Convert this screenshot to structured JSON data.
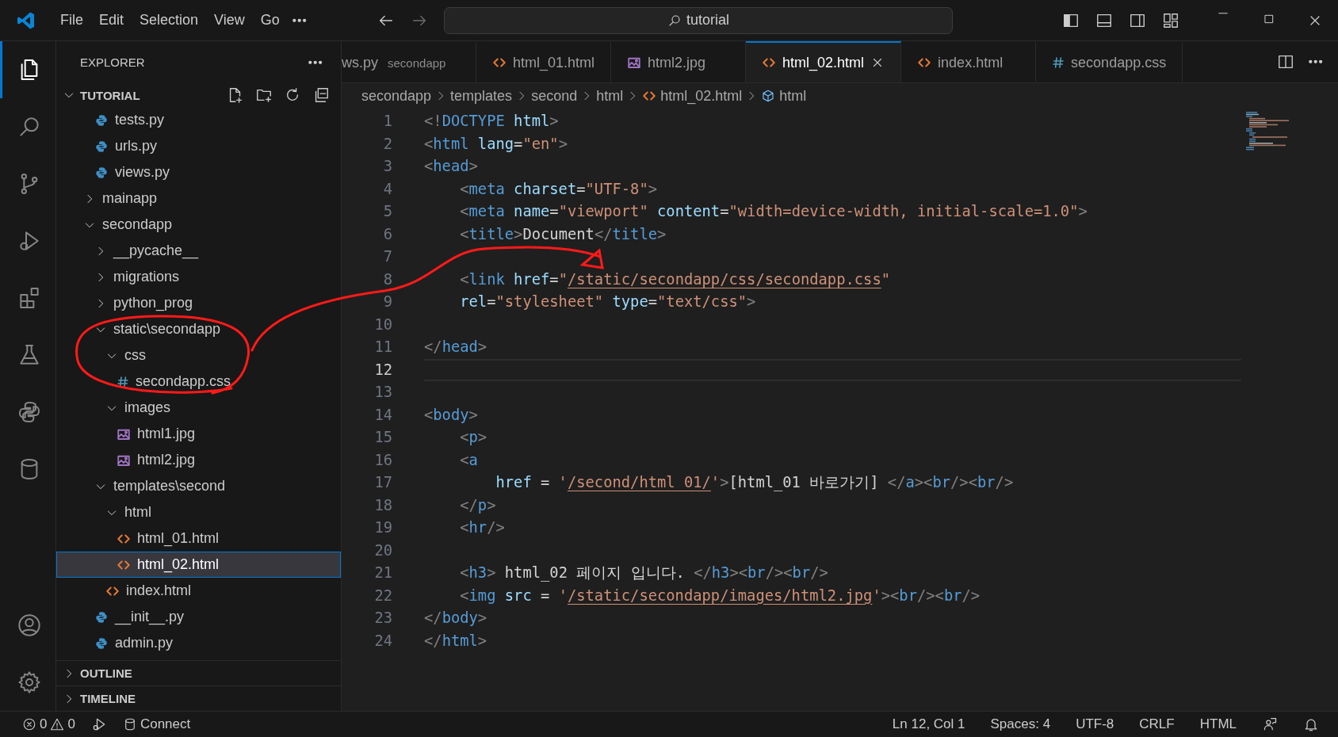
{
  "title_bar": {
    "menu": [
      "File",
      "Edit",
      "Selection",
      "View",
      "Go"
    ],
    "search": {
      "label": "tutorial"
    }
  },
  "activity_bar": {
    "items": [
      {
        "kind": "explorer",
        "selected": true
      },
      {
        "kind": "search",
        "selected": false
      },
      {
        "kind": "source_control",
        "selected": false
      },
      {
        "kind": "run_debug",
        "selected": false
      },
      {
        "kind": "extensions",
        "selected": false
      },
      {
        "kind": "testing",
        "selected": false
      },
      {
        "kind": "python",
        "selected": false
      },
      {
        "kind": "database",
        "selected": false
      }
    ],
    "bottom": [
      {
        "kind": "account"
      },
      {
        "kind": "settings"
      }
    ]
  },
  "explorer": {
    "title": "EXPLORER",
    "section": "TUTORIAL",
    "tree_continued": [
      {
        "label": "tests.py",
        "kind": "python",
        "selected": false
      },
      {
        "label": "urls.py",
        "kind": "python",
        "selected": false
      },
      {
        "label": "views.py",
        "kind": "python",
        "selected": false
      }
    ],
    "tree": [
      {
        "label": "mainapp",
        "kind": "folder",
        "expanded": false,
        "selected": false
      },
      {
        "label": "secondapp",
        "kind": "folder",
        "expanded": true,
        "selected": false,
        "children": [
          {
            "label": "__pycache__",
            "kind": "folder",
            "expanded": false,
            "selected": false
          },
          {
            "label": "migrations",
            "kind": "folder",
            "expanded": false,
            "selected": false
          },
          {
            "label": "python_prog",
            "kind": "folder",
            "expanded": false,
            "selected": false
          },
          {
            "label": "static\\secondapp",
            "kind": "folder",
            "expanded": true,
            "selected": false,
            "children": [
              {
                "label": "css",
                "kind": "folder",
                "expanded": true,
                "selected": false,
                "children": [
                  {
                    "label": "secondapp.css",
                    "kind": "css",
                    "selected": false
                  }
                ]
              },
              {
                "label": "images",
                "kind": "folder",
                "expanded": true,
                "selected": false,
                "children": [
                  {
                    "label": "html1.jpg",
                    "kind": "image",
                    "selected": false
                  },
                  {
                    "label": "html2.jpg",
                    "kind": "image",
                    "selected": false
                  }
                ]
              }
            ]
          },
          {
            "label": "templates\\second",
            "kind": "folder",
            "expanded": true,
            "selected": false,
            "children": [
              {
                "label": "html",
                "kind": "folder",
                "expanded": true,
                "selected": false,
                "children": [
                  {
                    "label": "html_01.html",
                    "kind": "html",
                    "selected": false
                  },
                  {
                    "label": "html_02.html",
                    "kind": "html",
                    "selected": true
                  }
                ]
              },
              {
                "label": "index.html",
                "kind": "html",
                "selected": false
              }
            ]
          },
          {
            "label": "__init__.py",
            "kind": "python",
            "selected": false
          },
          {
            "label": "admin.py",
            "kind": "python",
            "selected": false
          }
        ]
      }
    ],
    "panels": [
      {
        "label": "OUTLINE",
        "expanded": false
      },
      {
        "label": "TIMELINE",
        "expanded": false
      }
    ]
  },
  "tabs": [
    {
      "label": "ws.py",
      "detail": "secondapp",
      "selected": false
    },
    {
      "label": "html_01.html",
      "kind": "html",
      "selected": false
    },
    {
      "label": "html2.jpg",
      "kind": "image",
      "selected": false
    },
    {
      "label": "html_02.html",
      "kind": "html",
      "selected": true
    },
    {
      "label": "index.html",
      "kind": "html",
      "selected": false
    },
    {
      "label": "secondapp.css",
      "kind": "css",
      "selected": false
    }
  ],
  "breadcrumb": [
    {
      "label": "secondapp"
    },
    {
      "label": "templates"
    },
    {
      "label": "second"
    },
    {
      "label": "html"
    },
    {
      "label": "html_02.html",
      "kind": "html"
    },
    {
      "label": "html",
      "kind": "element"
    }
  ],
  "editor": {
    "lines": [
      {
        "number": "1",
        "current": false,
        "tokens": [
          {
            "kind": "punct",
            "text": "<!"
          },
          {
            "kind": "tag",
            "text": "DOCTYPE"
          },
          {
            "kind": "attr",
            "text": " html"
          },
          {
            "kind": "punct",
            "text": ">"
          }
        ]
      },
      {
        "number": "2",
        "current": false,
        "tokens": [
          {
            "kind": "punct",
            "text": "<"
          },
          {
            "kind": "tag",
            "text": "html"
          },
          {
            "kind": "attr",
            "text": " lang"
          },
          {
            "kind": "text",
            "text": "="
          },
          {
            "kind": "string",
            "text": "\"en\""
          },
          {
            "kind": "punct",
            "text": ">"
          }
        ]
      },
      {
        "number": "3",
        "current": false,
        "tokens": [
          {
            "kind": "punct",
            "text": "<"
          },
          {
            "kind": "tag",
            "text": "head"
          },
          {
            "kind": "punct",
            "text": ">"
          }
        ]
      },
      {
        "number": "4",
        "current": false,
        "tokens": [
          {
            "kind": "punct",
            "text": "    <"
          },
          {
            "kind": "tag",
            "text": "meta"
          },
          {
            "kind": "attr",
            "text": " charset"
          },
          {
            "kind": "text",
            "text": "="
          },
          {
            "kind": "string",
            "text": "\"UTF-8\""
          },
          {
            "kind": "punct",
            "text": ">"
          }
        ]
      },
      {
        "number": "5",
        "current": false,
        "tokens": [
          {
            "kind": "punct",
            "text": "    <"
          },
          {
            "kind": "tag",
            "text": "meta"
          },
          {
            "kind": "attr",
            "text": " name"
          },
          {
            "kind": "text",
            "text": "="
          },
          {
            "kind": "string",
            "text": "\"viewport\""
          },
          {
            "kind": "attr",
            "text": " content"
          },
          {
            "kind": "text",
            "text": "="
          },
          {
            "kind": "string",
            "text": "\"width=device-width, initial-scale=1.0\""
          },
          {
            "kind": "punct",
            "text": ">"
          }
        ]
      },
      {
        "number": "6",
        "current": false,
        "tokens": [
          {
            "kind": "punct",
            "text": "    <"
          },
          {
            "kind": "tag",
            "text": "title"
          },
          {
            "kind": "punct",
            "text": ">"
          },
          {
            "kind": "text",
            "text": "Document"
          },
          {
            "kind": "punct",
            "text": "</"
          },
          {
            "kind": "tag",
            "text": "title"
          },
          {
            "kind": "punct",
            "text": ">"
          }
        ]
      },
      {
        "number": "7",
        "current": false
      },
      {
        "number": "8",
        "current": false,
        "tokens": [
          {
            "kind": "punct",
            "text": "    <"
          },
          {
            "kind": "tag",
            "text": "link"
          },
          {
            "kind": "attr",
            "text": " href"
          },
          {
            "kind": "text",
            "text": "="
          },
          {
            "kind": "string",
            "text": "\""
          },
          {
            "kind": "link",
            "text": "/static/secondapp/css/secondapp.css"
          },
          {
            "kind": "string",
            "text": "\""
          }
        ]
      },
      {
        "number": "9",
        "current": false,
        "tokens": [
          {
            "kind": "attr",
            "text": "    rel"
          },
          {
            "kind": "text",
            "text": "="
          },
          {
            "kind": "string",
            "text": "\"stylesheet\""
          },
          {
            "kind": "attr",
            "text": " type"
          },
          {
            "kind": "text",
            "text": "="
          },
          {
            "kind": "string",
            "text": "\"text/css\""
          },
          {
            "kind": "punct",
            "text": ">"
          }
        ]
      },
      {
        "number": "10",
        "current": false
      },
      {
        "number": "11",
        "current": false,
        "tokens": [
          {
            "kind": "punct",
            "text": "</"
          },
          {
            "kind": "tag",
            "text": "head"
          },
          {
            "kind": "punct",
            "text": ">"
          }
        ]
      },
      {
        "number": "12",
        "current": true
      },
      {
        "number": "13",
        "current": false
      },
      {
        "number": "14",
        "current": false,
        "tokens": [
          {
            "kind": "punct",
            "text": "<"
          },
          {
            "kind": "tag",
            "text": "body"
          },
          {
            "kind": "punct",
            "text": ">"
          }
        ]
      },
      {
        "number": "15",
        "current": false,
        "tokens": [
          {
            "kind": "punct",
            "text": "    <"
          },
          {
            "kind": "tag",
            "text": "p"
          },
          {
            "kind": "punct",
            "text": ">"
          }
        ]
      },
      {
        "number": "16",
        "current": false,
        "tokens": [
          {
            "kind": "punct",
            "text": "    <"
          },
          {
            "kind": "tag",
            "text": "a"
          }
        ]
      },
      {
        "number": "17",
        "current": false,
        "tokens": [
          {
            "kind": "attr",
            "text": "        href"
          },
          {
            "kind": "text",
            "text": " = "
          },
          {
            "kind": "string",
            "text": "'"
          },
          {
            "kind": "link",
            "text": "/second/html_01/"
          },
          {
            "kind": "string",
            "text": "'"
          },
          {
            "kind": "punct",
            "text": ">"
          },
          {
            "kind": "text",
            "text": "[html_01 바로가기] "
          },
          {
            "kind": "punct",
            "text": "</"
          },
          {
            "kind": "tag",
            "text": "a"
          },
          {
            "kind": "punct",
            "text": "><"
          },
          {
            "kind": "tag",
            "text": "br"
          },
          {
            "kind": "punct",
            "text": "/><"
          },
          {
            "kind": "tag",
            "text": "br"
          },
          {
            "kind": "punct",
            "text": "/>"
          }
        ]
      },
      {
        "number": "18",
        "current": false,
        "tokens": [
          {
            "kind": "punct",
            "text": "    </"
          },
          {
            "kind": "tag",
            "text": "p"
          },
          {
            "kind": "punct",
            "text": ">"
          }
        ]
      },
      {
        "number": "19",
        "current": false,
        "tokens": [
          {
            "kind": "punct",
            "text": "    <"
          },
          {
            "kind": "tag",
            "text": "hr"
          },
          {
            "kind": "punct",
            "text": "/>"
          }
        ]
      },
      {
        "number": "20",
        "current": false
      },
      {
        "number": "21",
        "current": false,
        "tokens": [
          {
            "kind": "punct",
            "text": "    <"
          },
          {
            "kind": "tag",
            "text": "h3"
          },
          {
            "kind": "punct",
            "text": ">"
          },
          {
            "kind": "text",
            "text": " html_02 페이지 입니다. "
          },
          {
            "kind": "punct",
            "text": "</"
          },
          {
            "kind": "tag",
            "text": "h3"
          },
          {
            "kind": "punct",
            "text": "><"
          },
          {
            "kind": "tag",
            "text": "br"
          },
          {
            "kind": "punct",
            "text": "/><"
          },
          {
            "kind": "tag",
            "text": "br"
          },
          {
            "kind": "punct",
            "text": "/>"
          }
        ]
      },
      {
        "number": "22",
        "current": false,
        "tokens": [
          {
            "kind": "punct",
            "text": "    <"
          },
          {
            "kind": "tag",
            "text": "img"
          },
          {
            "kind": "attr",
            "text": " src"
          },
          {
            "kind": "text",
            "text": " = "
          },
          {
            "kind": "string",
            "text": "'"
          },
          {
            "kind": "link",
            "text": "/static/secondapp/images/html2.jpg"
          },
          {
            "kind": "string",
            "text": "'"
          },
          {
            "kind": "punct",
            "text": "><"
          },
          {
            "kind": "tag",
            "text": "br"
          },
          {
            "kind": "punct",
            "text": "/><"
          },
          {
            "kind": "tag",
            "text": "br"
          },
          {
            "kind": "punct",
            "text": "/>"
          }
        ]
      },
      {
        "number": "23",
        "current": false,
        "tokens": [
          {
            "kind": "punct",
            "text": "</"
          },
          {
            "kind": "tag",
            "text": "body"
          },
          {
            "kind": "punct",
            "text": ">"
          }
        ]
      },
      {
        "number": "24",
        "current": false,
        "tokens": [
          {
            "kind": "punct",
            "text": "</"
          },
          {
            "kind": "tag",
            "text": "html"
          },
          {
            "kind": "punct",
            "text": ">"
          }
        ]
      }
    ]
  },
  "status_bar": {
    "errors": "0",
    "warnings": "0",
    "connect": "Connect",
    "items": [
      "Ln 12, Col 1",
      "Spaces: 4",
      "UTF-8",
      "CRLF",
      "HTML"
    ]
  }
}
